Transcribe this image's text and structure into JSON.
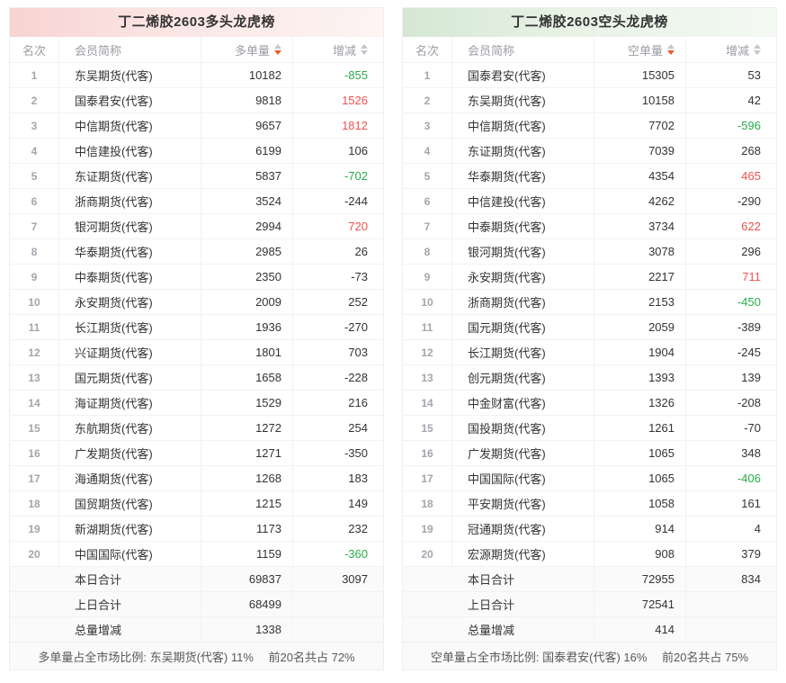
{
  "colors": {
    "increase_red": "#f0504e",
    "decrease_green": "#2bab4b",
    "neutral": "#333333",
    "sort_active_orange": "#f0582b",
    "long_theme_pink": "#f7d3d1",
    "short_theme_green": "#d5e7d3"
  },
  "tables": [
    {
      "title": "丁二烯胶2603多头龙虎榜",
      "columns": {
        "rank": "名次",
        "member": "会员简称",
        "volume": "多单量",
        "change": "增减"
      },
      "rows": [
        {
          "rank": "1",
          "member": "东吴期货(代客)",
          "volume": "10182",
          "change": "-855",
          "change_color": "decrease_green"
        },
        {
          "rank": "2",
          "member": "国泰君安(代客)",
          "volume": "9818",
          "change": "1526",
          "change_color": "increase_red"
        },
        {
          "rank": "3",
          "member": "中信期货(代客)",
          "volume": "9657",
          "change": "1812",
          "change_color": "increase_red"
        },
        {
          "rank": "4",
          "member": "中信建投(代客)",
          "volume": "6199",
          "change": "106",
          "change_color": "neutral"
        },
        {
          "rank": "5",
          "member": "东证期货(代客)",
          "volume": "5837",
          "change": "-702",
          "change_color": "decrease_green"
        },
        {
          "rank": "6",
          "member": "浙商期货(代客)",
          "volume": "3524",
          "change": "-244",
          "change_color": "neutral"
        },
        {
          "rank": "7",
          "member": "银河期货(代客)",
          "volume": "2994",
          "change": "720",
          "change_color": "increase_red"
        },
        {
          "rank": "8",
          "member": "华泰期货(代客)",
          "volume": "2985",
          "change": "26",
          "change_color": "neutral"
        },
        {
          "rank": "9",
          "member": "中泰期货(代客)",
          "volume": "2350",
          "change": "-73",
          "change_color": "neutral"
        },
        {
          "rank": "10",
          "member": "永安期货(代客)",
          "volume": "2009",
          "change": "252",
          "change_color": "neutral"
        },
        {
          "rank": "11",
          "member": "长江期货(代客)",
          "volume": "1936",
          "change": "-270",
          "change_color": "neutral"
        },
        {
          "rank": "12",
          "member": "兴证期货(代客)",
          "volume": "1801",
          "change": "703",
          "change_color": "neutral"
        },
        {
          "rank": "13",
          "member": "国元期货(代客)",
          "volume": "1658",
          "change": "-228",
          "change_color": "neutral"
        },
        {
          "rank": "14",
          "member": "海证期货(代客)",
          "volume": "1529",
          "change": "216",
          "change_color": "neutral"
        },
        {
          "rank": "15",
          "member": "东航期货(代客)",
          "volume": "1272",
          "change": "254",
          "change_color": "neutral"
        },
        {
          "rank": "16",
          "member": "广发期货(代客)",
          "volume": "1271",
          "change": "-350",
          "change_color": "neutral"
        },
        {
          "rank": "17",
          "member": "海通期货(代客)",
          "volume": "1268",
          "change": "183",
          "change_color": "neutral"
        },
        {
          "rank": "18",
          "member": "国贸期货(代客)",
          "volume": "1215",
          "change": "149",
          "change_color": "neutral"
        },
        {
          "rank": "19",
          "member": "新湖期货(代客)",
          "volume": "1173",
          "change": "232",
          "change_color": "neutral"
        },
        {
          "rank": "20",
          "member": "中国国际(代客)",
          "volume": "1159",
          "change": "-360",
          "change_color": "decrease_green"
        }
      ],
      "totals": [
        {
          "label": "本日合计",
          "volume": "69837",
          "change": "3097"
        },
        {
          "label": "上日合计",
          "volume": "68499",
          "change": ""
        },
        {
          "label": "总量增减",
          "volume": "1338",
          "change": ""
        }
      ],
      "footnote": "多单量占全市场比例: 东吴期货(代客) 11%　 前20名共占 72%"
    },
    {
      "title": "丁二烯胶2603空头龙虎榜",
      "columns": {
        "rank": "名次",
        "member": "会员简称",
        "volume": "空单量",
        "change": "增减"
      },
      "rows": [
        {
          "rank": "1",
          "member": "国泰君安(代客)",
          "volume": "15305",
          "change": "53",
          "change_color": "neutral"
        },
        {
          "rank": "2",
          "member": "东吴期货(代客)",
          "volume": "10158",
          "change": "42",
          "change_color": "neutral"
        },
        {
          "rank": "3",
          "member": "中信期货(代客)",
          "volume": "7702",
          "change": "-596",
          "change_color": "decrease_green"
        },
        {
          "rank": "4",
          "member": "东证期货(代客)",
          "volume": "7039",
          "change": "268",
          "change_color": "neutral"
        },
        {
          "rank": "5",
          "member": "华泰期货(代客)",
          "volume": "4354",
          "change": "465",
          "change_color": "increase_red"
        },
        {
          "rank": "6",
          "member": "中信建投(代客)",
          "volume": "4262",
          "change": "-290",
          "change_color": "neutral"
        },
        {
          "rank": "7",
          "member": "中泰期货(代客)",
          "volume": "3734",
          "change": "622",
          "change_color": "increase_red"
        },
        {
          "rank": "8",
          "member": "银河期货(代客)",
          "volume": "3078",
          "change": "296",
          "change_color": "neutral"
        },
        {
          "rank": "9",
          "member": "永安期货(代客)",
          "volume": "2217",
          "change": "711",
          "change_color": "increase_red"
        },
        {
          "rank": "10",
          "member": "浙商期货(代客)",
          "volume": "2153",
          "change": "-450",
          "change_color": "decrease_green"
        },
        {
          "rank": "11",
          "member": "国元期货(代客)",
          "volume": "2059",
          "change": "-389",
          "change_color": "neutral"
        },
        {
          "rank": "12",
          "member": "长江期货(代客)",
          "volume": "1904",
          "change": "-245",
          "change_color": "neutral"
        },
        {
          "rank": "13",
          "member": "创元期货(代客)",
          "volume": "1393",
          "change": "139",
          "change_color": "neutral"
        },
        {
          "rank": "14",
          "member": "中金财富(代客)",
          "volume": "1326",
          "change": "-208",
          "change_color": "neutral"
        },
        {
          "rank": "15",
          "member": "国投期货(代客)",
          "volume": "1261",
          "change": "-70",
          "change_color": "neutral"
        },
        {
          "rank": "16",
          "member": "广发期货(代客)",
          "volume": "1065",
          "change": "348",
          "change_color": "neutral"
        },
        {
          "rank": "17",
          "member": "中国国际(代客)",
          "volume": "1065",
          "change": "-406",
          "change_color": "decrease_green"
        },
        {
          "rank": "18",
          "member": "平安期货(代客)",
          "volume": "1058",
          "change": "161",
          "change_color": "neutral"
        },
        {
          "rank": "19",
          "member": "冠通期货(代客)",
          "volume": "914",
          "change": "4",
          "change_color": "neutral"
        },
        {
          "rank": "20",
          "member": "宏源期货(代客)",
          "volume": "908",
          "change": "379",
          "change_color": "neutral"
        }
      ],
      "totals": [
        {
          "label": "本日合计",
          "volume": "72955",
          "change": "834"
        },
        {
          "label": "上日合计",
          "volume": "72541",
          "change": ""
        },
        {
          "label": "总量增减",
          "volume": "414",
          "change": ""
        }
      ],
      "footnote": "空单量占全市场比例: 国泰君安(代客) 16%　 前20名共占 75%"
    }
  ]
}
